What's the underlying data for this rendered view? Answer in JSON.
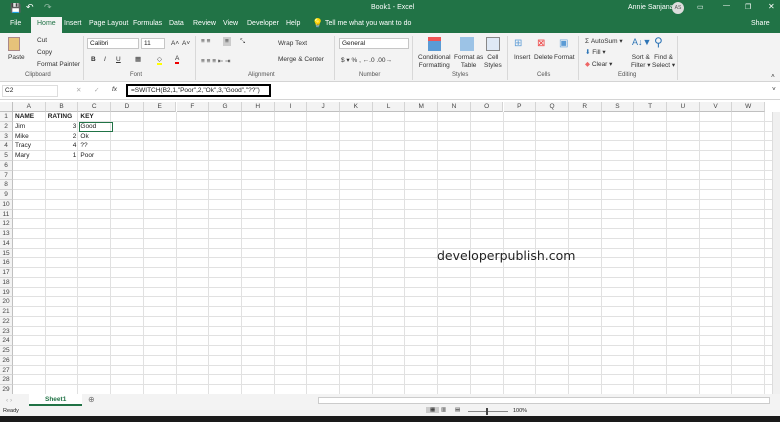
{
  "titlebar": {
    "title": "Book1 - Excel",
    "user": "Annie Sanjana",
    "initials": "AS"
  },
  "tabs": [
    "File",
    "Home",
    "Insert",
    "Page Layout",
    "Formulas",
    "Data",
    "Review",
    "View",
    "Developer",
    "Help"
  ],
  "tell_me": "Tell me what you want to do",
  "share": "Share",
  "ribbon": {
    "clipboard": {
      "paste": "Paste",
      "cut": "Cut",
      "copy": "Copy",
      "format_painter": "Format Painter",
      "label": "Clipboard"
    },
    "font": {
      "name": "Calibri",
      "size": "11",
      "bold": "B",
      "italic": "I",
      "underline": "U",
      "label": "Font"
    },
    "alignment": {
      "wrap": "Wrap Text",
      "merge": "Merge & Center",
      "label": "Alignment"
    },
    "number": {
      "format": "General",
      "label": "Number"
    },
    "styles": {
      "cond1": "Conditional",
      "cond2": "Formatting",
      "fmt1": "Format as",
      "fmt2": "Table",
      "cell1": "Cell",
      "cell2": "Styles",
      "label": "Styles"
    },
    "cells": {
      "insert": "Insert",
      "delete": "Delete",
      "format": "Format",
      "label": "Cells"
    },
    "editing": {
      "autosum": "AutoSum",
      "fill": "Fill",
      "clear": "Clear",
      "sort1": "Sort &",
      "sort2": "Filter",
      "find1": "Find &",
      "find2": "Select",
      "label": "Editing"
    }
  },
  "formula_bar": {
    "name_box": "C2",
    "formula": "=SWITCH(B2,1,\"Poor\",2,\"Ok\",3,\"Good\",\"??\")"
  },
  "columns": [
    "A",
    "B",
    "C",
    "D",
    "E",
    "F",
    "G",
    "H",
    "I",
    "J",
    "K",
    "L",
    "M",
    "N",
    "O",
    "P",
    "Q",
    "R",
    "S",
    "T",
    "U",
    "V",
    "W"
  ],
  "cells": [
    [
      "NAME",
      "RATING",
      "KEY"
    ],
    [
      "Jim",
      "3",
      "Good"
    ],
    [
      "Mike",
      "2",
      "Ok"
    ],
    [
      "Tracy",
      "4",
      "??"
    ],
    [
      "Mary",
      "1",
      "Poor"
    ]
  ],
  "row_count": 29,
  "watermark": "developerpublish.com",
  "sheet_tab": "Sheet1",
  "status": {
    "text": "Ready",
    "zoom": "100%"
  },
  "colors": {
    "accent": "#217346"
  }
}
